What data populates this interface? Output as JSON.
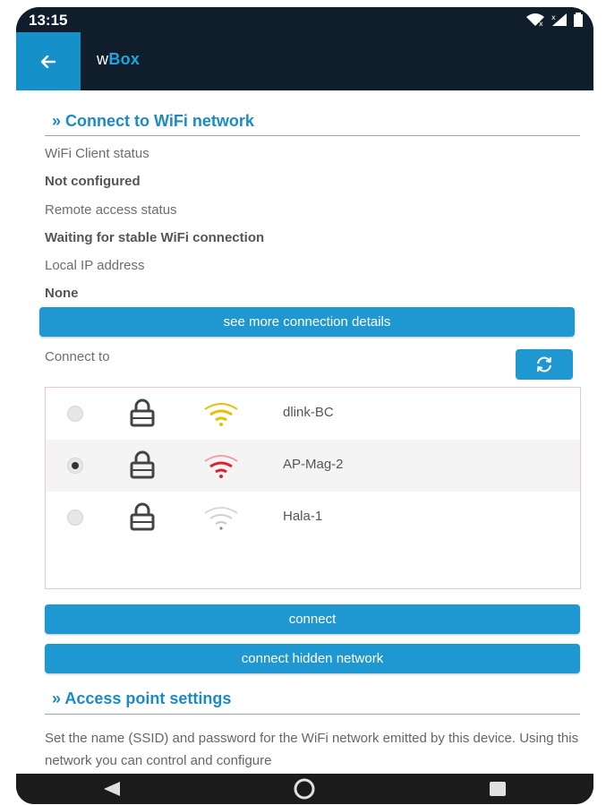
{
  "status_bar": {
    "time": "13:15"
  },
  "app_bar": {
    "title_prefix": "w",
    "title_brand": "Box"
  },
  "wifi_section": {
    "title": "» Connect to WiFi network",
    "client_status_label": "WiFi Client status",
    "client_status_value": "Not configured",
    "remote_status_label": "Remote access status",
    "remote_status_value": "Waiting for stable WiFi connection",
    "local_ip_label": "Local IP address",
    "local_ip_value": "None",
    "details_button": "see more connection details",
    "connect_to_label": "Connect to",
    "networks": [
      {
        "name": "dlink-BC",
        "selected": false,
        "signal_color": "#e8c000"
      },
      {
        "name": "AP-Mag-2",
        "selected": true,
        "signal_color": "#d9232d"
      },
      {
        "name": "Hala-1",
        "selected": false,
        "signal_color": "#bdbdbd"
      }
    ],
    "connect_button": "connect",
    "connect_hidden_button": "connect hidden network"
  },
  "ap_section": {
    "title": "» Access point settings",
    "description": "Set the name (SSID) and password for the WiFi network emitted by this device. Using this network you can control and configure"
  },
  "colors": {
    "accent": "#1f97d1",
    "header": "#0f1e2a"
  }
}
